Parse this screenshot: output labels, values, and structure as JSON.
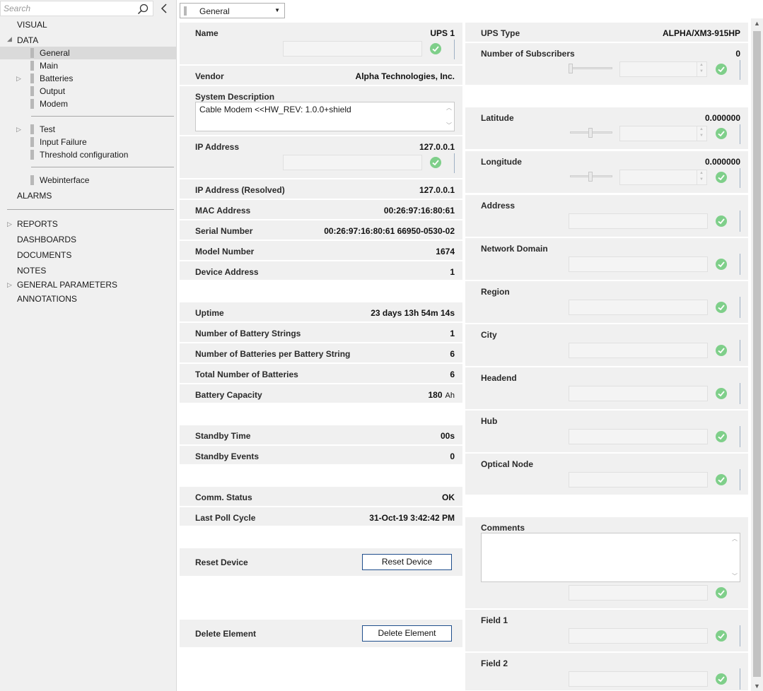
{
  "search": {
    "placeholder": "Search"
  },
  "sidebar": {
    "visual": "VISUAL",
    "data": "DATA",
    "data_items": [
      "General",
      "Main",
      "Batteries",
      "Output",
      "Modem"
    ],
    "group2": [
      "Test",
      "Input Failure",
      "Threshold configuration"
    ],
    "group3": [
      "Webinterface"
    ],
    "alarms": "ALARMS",
    "bottom": [
      "REPORTS",
      "DASHBOARDS",
      "DOCUMENTS",
      "NOTES",
      "GENERAL PARAMETERS",
      "ANNOTATIONS"
    ]
  },
  "view_select": {
    "value": "General"
  },
  "left": {
    "name": {
      "label": "Name",
      "value": "UPS 1"
    },
    "vendor": {
      "label": "Vendor",
      "value": "Alpha Technologies, Inc."
    },
    "system_description": {
      "label": "System Description",
      "value": "Cable Modem <<HW_REV: 1.0.0+shield"
    },
    "ip_address": {
      "label": "IP Address",
      "value": "127.0.0.1"
    },
    "ip_resolved": {
      "label": "IP Address (Resolved)",
      "value": "127.0.0.1"
    },
    "mac": {
      "label": "MAC Address",
      "value": "00:26:97:16:80:61"
    },
    "serial": {
      "label": "Serial Number",
      "value": "00:26:97:16:80:61 66950-0530-02"
    },
    "model": {
      "label": "Model Number",
      "value": "1674"
    },
    "device_address": {
      "label": "Device Address",
      "value": "1"
    },
    "uptime": {
      "label": "Uptime",
      "value": "23 days 13h 54m 14s"
    },
    "battery_strings": {
      "label": "Number of Battery Strings",
      "value": "1"
    },
    "batteries_per_string": {
      "label": "Number of Batteries per Battery String",
      "value": "6"
    },
    "total_batteries": {
      "label": "Total Number of Batteries",
      "value": "6"
    },
    "battery_capacity": {
      "label": "Battery Capacity",
      "value": "180",
      "unit": "Ah"
    },
    "standby_time": {
      "label": "Standby Time",
      "value": "00s"
    },
    "standby_events": {
      "label": "Standby Events",
      "value": "0"
    },
    "comm_status": {
      "label": "Comm. Status",
      "value": "OK"
    },
    "last_poll": {
      "label": "Last Poll Cycle",
      "value": "31-Oct-19 3:42:42 PM"
    },
    "reset": {
      "label": "Reset Device",
      "button": "Reset Device"
    },
    "delete": {
      "label": "Delete Element",
      "button": "Delete Element"
    }
  },
  "right": {
    "ups_type": {
      "label": "UPS Type",
      "value": "ALPHA/XM3-915HP"
    },
    "subscribers": {
      "label": "Number of Subscribers",
      "value": "0"
    },
    "latitude": {
      "label": "Latitude",
      "value": "0.000000"
    },
    "longitude": {
      "label": "Longitude",
      "value": "0.000000"
    },
    "address": {
      "label": "Address"
    },
    "network_domain": {
      "label": "Network Domain"
    },
    "region": {
      "label": "Region"
    },
    "city": {
      "label": "City"
    },
    "headend": {
      "label": "Headend"
    },
    "hub": {
      "label": "Hub"
    },
    "optical_node": {
      "label": "Optical Node"
    },
    "comments": {
      "label": "Comments"
    },
    "field1": {
      "label": "Field 1"
    },
    "field2": {
      "label": "Field 2"
    }
  },
  "colors": {
    "check": "#7fcf8a",
    "button_border": "#1f4e8c",
    "row_bg": "#f0f0f0"
  }
}
